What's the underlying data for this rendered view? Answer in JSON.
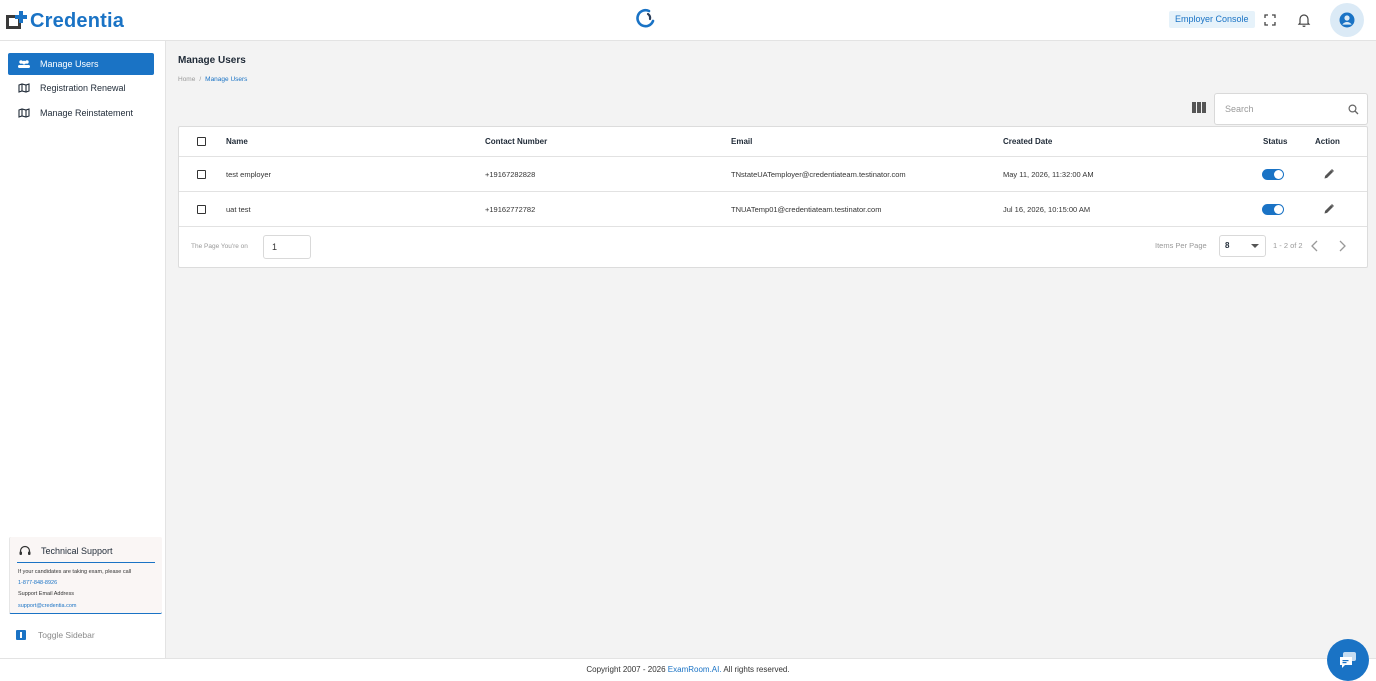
{
  "header": {
    "logo_text": "Credentia",
    "console_label": "Employer Console",
    "icons": {
      "fullscreen": "fullscreen-icon",
      "notifications": "bell-icon",
      "account": "account-circle-icon",
      "center_logo": "examroom-logo-icon"
    }
  },
  "sidebar": {
    "items": [
      {
        "label": "Manage Users",
        "icon": "users-icon",
        "active": true
      },
      {
        "label": "Registration Renewal",
        "icon": "map-icon",
        "active": false
      },
      {
        "label": "Manage Reinstatement",
        "icon": "map-icon",
        "active": false
      }
    ],
    "support": {
      "title": "Technical Support",
      "line1": "If your candidates are taking exam, please call",
      "phone": "1-877-848-8926",
      "email_label": "Support Email Address",
      "email": "support@credentia.com"
    },
    "toggle_label": "Toggle Sidebar"
  },
  "main": {
    "title": "Manage Users",
    "breadcrumb": {
      "home": "Home",
      "separator": "/",
      "current": "Manage Users"
    },
    "search": {
      "placeholder": "Search",
      "value": ""
    },
    "table": {
      "columns": [
        "Name",
        "Contact Number",
        "Email",
        "Created Date",
        "Status",
        "Action"
      ],
      "rows": [
        {
          "name": "test employer",
          "contact": "+19167282828",
          "email": "TNstateUATemployer@credentiateam.testinator.com",
          "created": "May 11, 2026, 11:32:00 AM",
          "status_on": true
        },
        {
          "name": "uat test",
          "contact": "+19162772782",
          "email": "TNUATemp01@credentiateam.testinator.com",
          "created": "Jul 16, 2026, 10:15:00 AM",
          "status_on": true
        }
      ]
    },
    "pager": {
      "page_label": "The Page You're on",
      "page_value": "1",
      "items_label": "Items Per Page",
      "items_value": "8",
      "range": "1 - 2 of 2"
    }
  },
  "footer": {
    "prefix": "Copyright 2007 - 2026",
    "brand": "ExamRoom.AI.",
    "suffix": "All rights reserved."
  },
  "colors": {
    "accent": "#1a73c5",
    "background": "#f3f3f3"
  }
}
